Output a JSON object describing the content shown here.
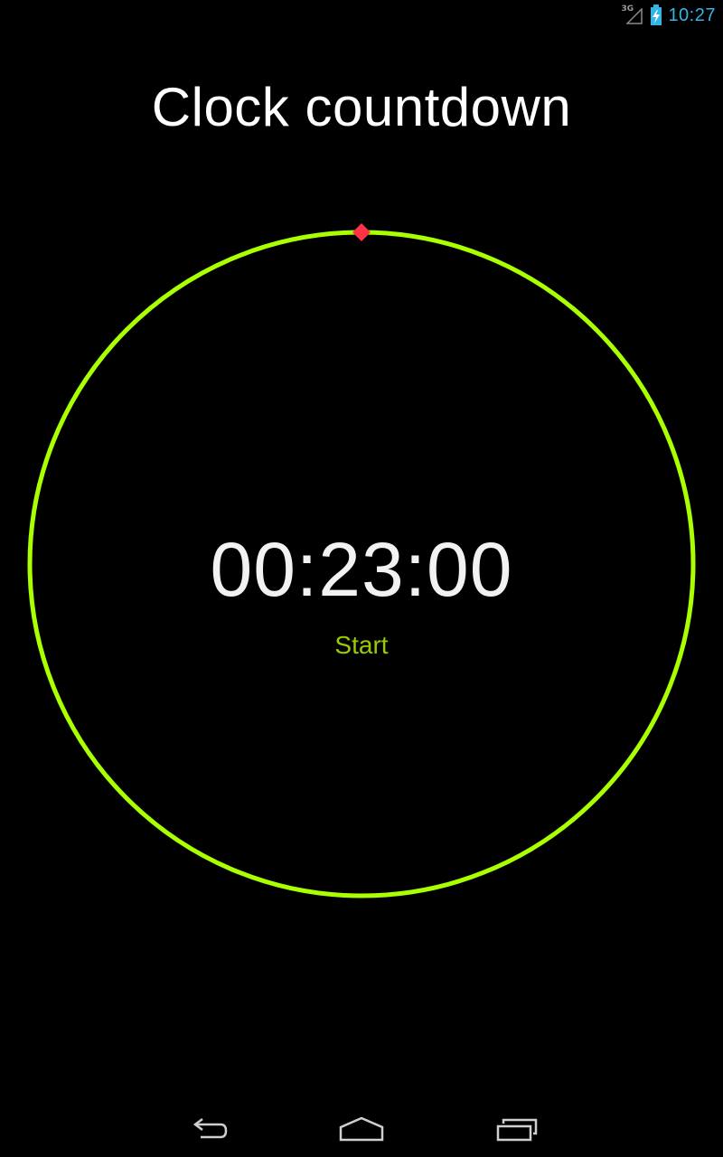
{
  "status_bar": {
    "network_label": "3G",
    "network_icon": "signal-icon",
    "battery_icon": "battery-charging-icon",
    "time": "10:27",
    "time_color": "#33b5e5"
  },
  "app": {
    "title": "Clock countdown"
  },
  "timer": {
    "time": "00:23:00",
    "start_label": "Start",
    "ring_color": "#aaff00",
    "marker_color": "#ff3344",
    "accent_color": "#99cc00"
  },
  "nav_bar": {
    "back_icon": "back-icon",
    "home_icon": "home-icon",
    "recents_icon": "recents-icon"
  }
}
